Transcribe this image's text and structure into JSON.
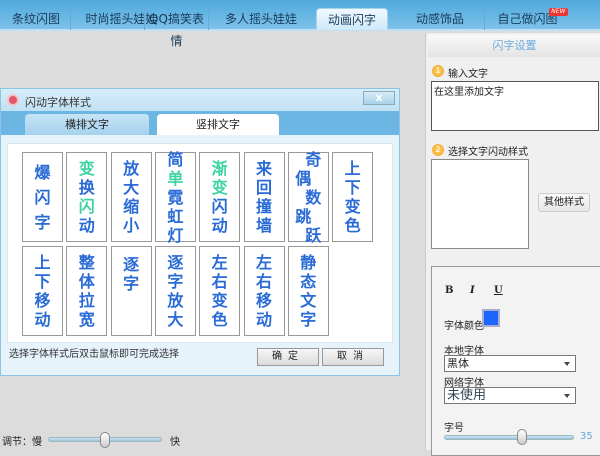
{
  "nav": {
    "tabs": [
      {
        "label": "条纹闪图"
      },
      {
        "label": "时尚摇头娃娃"
      },
      {
        "label": "QQ搞笑表情"
      },
      {
        "label": "多人摇头娃娃"
      },
      {
        "label": "动画闪字",
        "active": true
      },
      {
        "label": "动感饰品"
      },
      {
        "label": "自己做闪图",
        "badge": "NEW"
      }
    ]
  },
  "dialog": {
    "title": "闪动字体样式",
    "close": "x",
    "tabs": [
      {
        "label": "横排文字"
      },
      {
        "label": "竖排文字",
        "active": true
      }
    ],
    "styles": [
      {
        "chars": [
          "爆",
          "闪",
          "字"
        ],
        "green": []
      },
      {
        "chars": [
          "变",
          "换",
          "闪",
          "动"
        ],
        "green": [
          0,
          2
        ]
      },
      {
        "chars": [
          "放",
          "大",
          "缩",
          "小"
        ],
        "green": []
      },
      {
        "chars": [
          "简",
          "单",
          "霓",
          "虹",
          "灯"
        ],
        "green": [
          1
        ]
      },
      {
        "chars": [
          "渐",
          "变",
          "闪",
          "动"
        ],
        "green": [
          0,
          1
        ]
      },
      {
        "chars": [
          "来",
          "回",
          "撞",
          "墙"
        ],
        "green": []
      },
      {
        "chars": [
          "奇",
          "偶",
          "数",
          "跳",
          "跃"
        ],
        "green": []
      },
      {
        "chars": [
          "上",
          "下",
          "变",
          "色"
        ],
        "green": []
      },
      {
        "chars": [
          "上",
          "下",
          "移",
          "动"
        ],
        "green": []
      },
      {
        "chars": [
          "整",
          "体",
          "拉",
          "宽"
        ],
        "green": []
      },
      {
        "chars": [
          "逐",
          "字"
        ],
        "green": []
      },
      {
        "chars": [
          "逐",
          "字",
          "放",
          "大"
        ],
        "green": []
      },
      {
        "chars": [
          "左",
          "右",
          "变",
          "色"
        ],
        "green": []
      },
      {
        "chars": [
          "左",
          "右",
          "移",
          "动"
        ],
        "green": []
      },
      {
        "chars": [
          "静",
          "态",
          "文",
          "字"
        ],
        "green": []
      }
    ],
    "hint": "选择字体样式后双击鼠标即可完成选择",
    "ok": "确定",
    "cancel": "取消"
  },
  "speed": {
    "label": "调节：慢",
    "fast": "快",
    "value_fraction": 0.5
  },
  "panel": {
    "title": "闪字设置",
    "step1": {
      "num": "1",
      "label": "输入文字",
      "value": "在这里添加文字"
    },
    "step2": {
      "num": "2",
      "label": "选择文字闪动样式",
      "other": "其他样式"
    },
    "bold": "B",
    "italic": "I",
    "underline": "U",
    "color_label": "字体颜色",
    "color": "#1a66ff",
    "local_font_label": "本地字体",
    "local_font": "黑体",
    "web_font_label": "网络字体",
    "web_font": "未使用",
    "size_label": "字号",
    "size": "35"
  },
  "colors": {
    "accent": "#2a6bd6",
    "green": "#3ed4a0"
  }
}
